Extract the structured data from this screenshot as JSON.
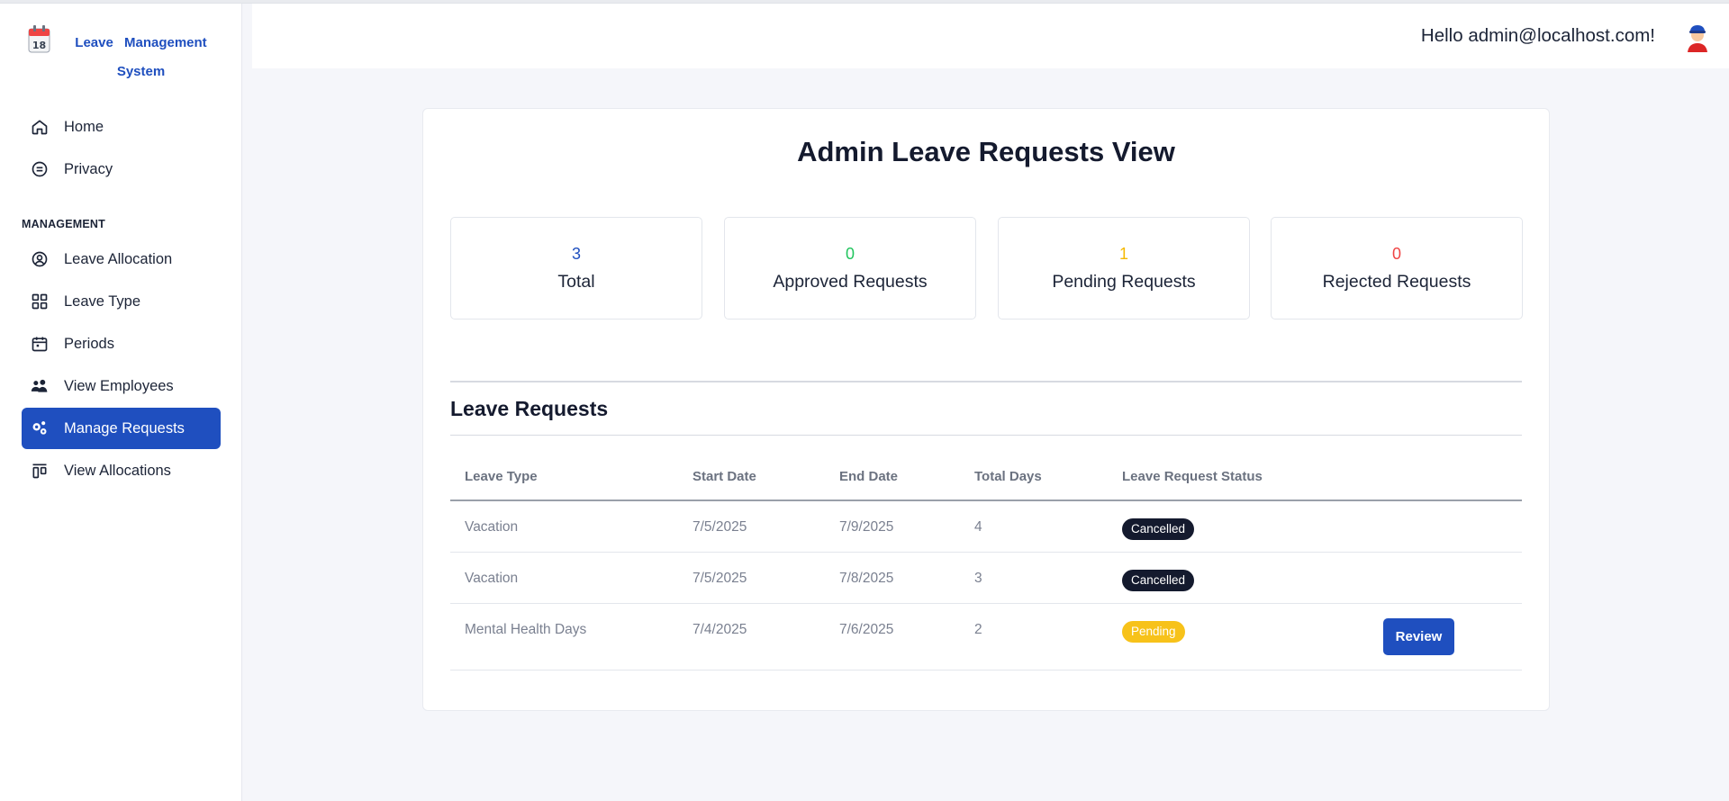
{
  "brand": {
    "name": "Leave Management System"
  },
  "nav": {
    "home": "Home",
    "privacy": "Privacy",
    "section_label": "MANAGEMENT",
    "leave_allocation": "Leave Allocation",
    "leave_type": "Leave Type",
    "periods": "Periods",
    "view_employees": "View Employees",
    "manage_requests": "Manage Requests",
    "view_allocations": "View Allocations"
  },
  "header": {
    "greeting": "Hello admin@localhost.com!"
  },
  "main": {
    "title": "Admin Leave Requests View",
    "stats": [
      {
        "value": "3",
        "label": "Total",
        "color": "#1f4fbf"
      },
      {
        "value": "0",
        "label": "Approved Requests",
        "color": "#22c55e"
      },
      {
        "value": "1",
        "label": "Pending Requests",
        "color": "#f5b800"
      },
      {
        "value": "0",
        "label": "Rejected Requests",
        "color": "#ef4444"
      }
    ],
    "section_title": "Leave Requests",
    "table": {
      "headers": [
        "Leave Type",
        "Start Date",
        "End Date",
        "Total Days",
        "Leave Request Status"
      ],
      "rows": [
        {
          "leave_type": "Vacation",
          "start": "7/5/2025",
          "end": "7/9/2025",
          "days": "4",
          "status": "Cancelled"
        },
        {
          "leave_type": "Vacation",
          "start": "7/5/2025",
          "end": "7/8/2025",
          "days": "3",
          "status": "Cancelled"
        },
        {
          "leave_type": "Mental Health Days",
          "start": "7/4/2025",
          "end": "7/6/2025",
          "days": "2",
          "status": "Pending",
          "action": "Review"
        }
      ]
    }
  },
  "colors": {
    "accent": "#1f4fbf",
    "cancelled": "#141a2e",
    "pending": "#f7c21a"
  }
}
